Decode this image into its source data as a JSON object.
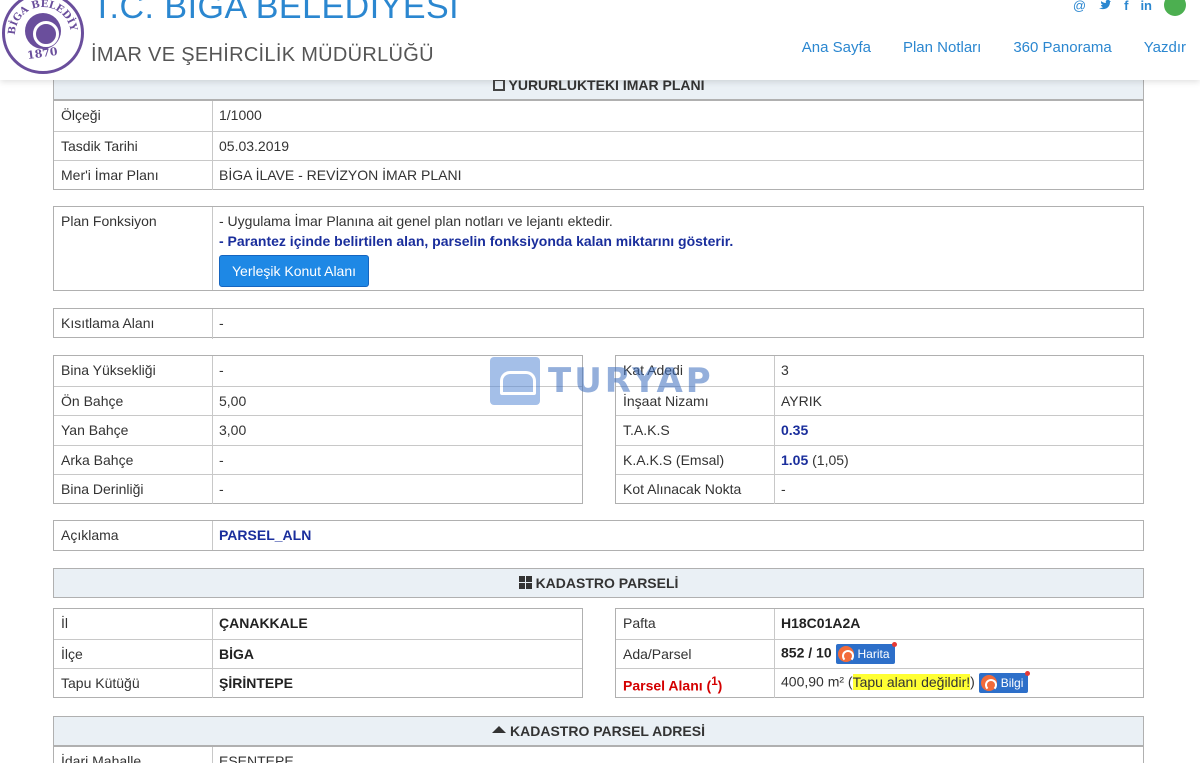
{
  "header": {
    "title": "T.C. BİGA BELEDİYESİ",
    "subtitle": "İMAR VE ŞEHİRCİLİK MÜDÜRLÜĞÜ",
    "logo_text": "BİGA BELEDİYESİ",
    "logo_year": "1870",
    "nav": [
      "Ana Sayfa",
      "Plan Notları",
      "360 Panorama",
      "Yazdır"
    ],
    "social_icons": [
      "at-icon",
      "twitter-icon",
      "facebook-icon",
      "linkedin-icon",
      "user-icon"
    ]
  },
  "imar_plani": {
    "heading": "YÜRÜRLÜKTEKİ İMAR PLANI",
    "rows": [
      {
        "label": "Ölçeği",
        "value": "1/1000"
      },
      {
        "label": "Tasdik Tarihi",
        "value": "05.03.2019"
      },
      {
        "label": "Mer'i İmar Planı",
        "value": "BİGA İLAVE - REVİZYON İMAR PLANI"
      }
    ]
  },
  "plan_fonksiyon": {
    "label": "Plan Fonksiyon",
    "note1": "- Uygulama İmar Planına ait genel plan notları ve lejantı ektedir.",
    "note2": "- Parantez içinde belirtilen alan, parselin fonksiyonda kalan miktarını gösterir.",
    "button": "Yerleşik Konut Alanı"
  },
  "kisitlama": {
    "label": "Kısıtlama Alanı",
    "value": "-"
  },
  "left_params": [
    {
      "label": "Bina Yüksekliği",
      "value": "-"
    },
    {
      "label": "Ön Bahçe",
      "value": "5,00"
    },
    {
      "label": "Yan Bahçe",
      "value": "3,00"
    },
    {
      "label": "Arka Bahçe",
      "value": "-"
    },
    {
      "label": "Bina Derinliği",
      "value": "-"
    }
  ],
  "right_params": {
    "kat_adedi": {
      "label": "Kat Adedi",
      "value": "3"
    },
    "insaat_nizami": {
      "label": "İnşaat Nizamı",
      "value": "AYRIK"
    },
    "taks": {
      "label": "T.A.K.S",
      "value": "0.35"
    },
    "kaks": {
      "label": "K.A.K.S (Emsal)",
      "value": "1.05",
      "extra": "(1,05)"
    },
    "kot": {
      "label": "Kot Alınacak Nokta",
      "value": "-"
    }
  },
  "aciklama": {
    "label": "Açıklama",
    "value": "PARSEL_ALN"
  },
  "watermark": "TURYAP",
  "kadastro": {
    "heading": "KADASTRO PARSELİ",
    "il": {
      "label": "İl",
      "value": "ÇANAKKALE"
    },
    "ilce": {
      "label": "İlçe",
      "value": "BİGA"
    },
    "tapu": {
      "label": "Tapu Kütüğü",
      "value": "ŞİRİNTEPE"
    },
    "pafta": {
      "label": "Pafta",
      "value": "H18C01A2A"
    },
    "ada": {
      "label": "Ada/Parsel",
      "value": "852 / 10",
      "button": "Harita"
    },
    "alan": {
      "label": "Parsel Alanı (",
      "sup": "1",
      "label_end": ")",
      "value": "400,90 m² (",
      "highlight": "Tapu alanı değildir!",
      "value_end": ")",
      "button": "Bilgi"
    }
  },
  "adres": {
    "heading": "KADASTRO PARSEL ADRESİ",
    "rows": [
      {
        "label": "İdari Mahalle",
        "value": "ESENTEPE"
      }
    ]
  }
}
